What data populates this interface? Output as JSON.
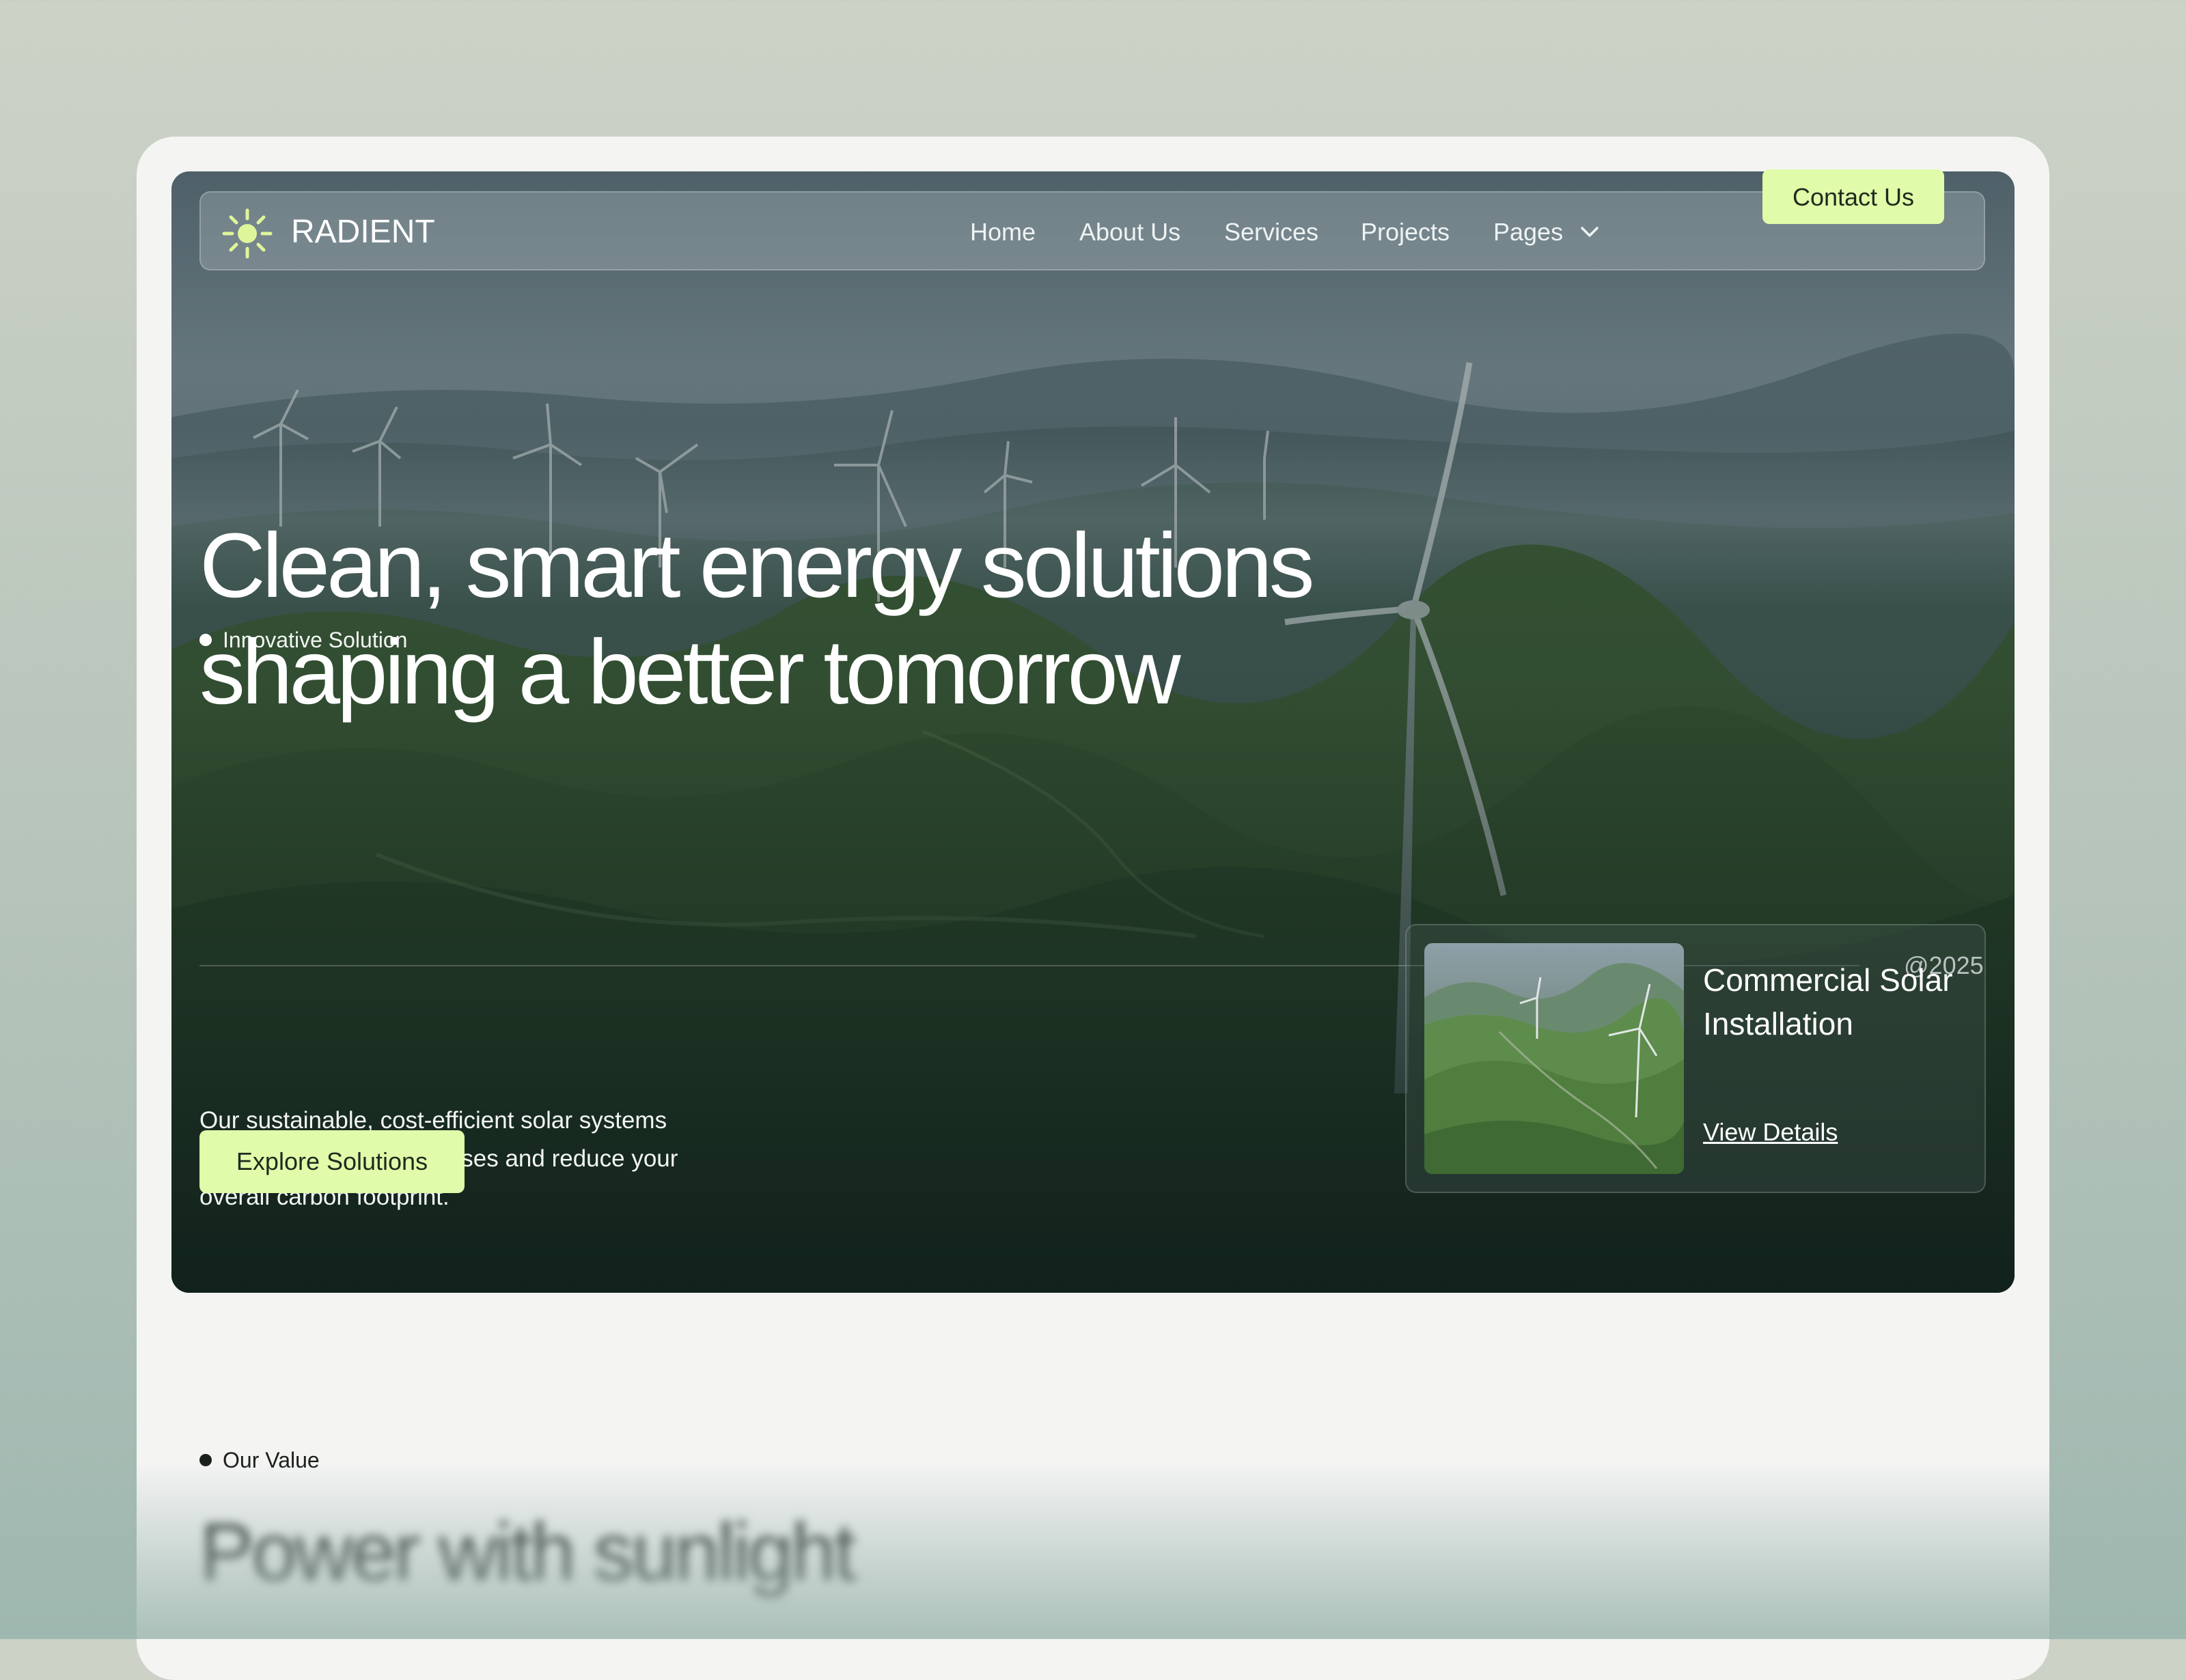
{
  "brand": {
    "name": "RADIENT",
    "icon": "sun-icon"
  },
  "nav": {
    "items": [
      "Home",
      "About Us",
      "Services",
      "Projects",
      "Pages"
    ],
    "contact_label": "Contact Us"
  },
  "hero": {
    "eyebrow": "Innovative Solution",
    "headline_line1": "Clean, smart energy solutions",
    "headline_line2": "shaping a better tomorrow",
    "year": "@2025",
    "description": "Our sustainable, cost-efficient solar systems lower your energy expenses and reduce your overall carbon footprint.",
    "cta_label": "Explore Solutions"
  },
  "card": {
    "title": "Commercial Solar Installation",
    "link_label": "View Details"
  },
  "value": {
    "eyebrow": "Our Value",
    "title": "Power with sunlight"
  },
  "colors": {
    "accent": "#e0fba9",
    "page_bg": "#f4f4f3",
    "hero_dark": "#14231f"
  }
}
